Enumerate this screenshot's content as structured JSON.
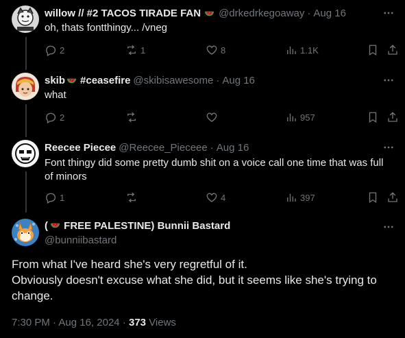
{
  "tweets": [
    {
      "name": "willow // #2 TACOS TIRADE FAN",
      "handle": "@drkedrkegoaway",
      "date": "Aug 16",
      "text": "oh, thats fontthingy... /vneg",
      "replies": "2",
      "reposts": "1",
      "likes": "8",
      "views": "1.1K"
    },
    {
      "name": "skib",
      "name_suffix": "#ceasefire",
      "handle": "@skibisawesome",
      "date": "Aug 16",
      "text": "what",
      "replies": "2",
      "reposts": "",
      "likes": "",
      "views": "957"
    },
    {
      "name": "Reecee Piecee",
      "handle": "@Reecee_Pieceee",
      "date": "Aug 16",
      "text": "Font thingy did some pretty dumb shit on a voice call one time that was full of minors",
      "replies": "1",
      "reposts": "",
      "likes": "4",
      "views": "397"
    }
  ],
  "main": {
    "name_prefix": "(",
    "name_rest": " FREE PALESTINE) Bunnii Bastard",
    "handle": "@bunniibastard",
    "line1": "From what I've heard she's very regretful of it.",
    "line2": "Obviously doesn't excuse what she did, but it seems like she's trying to change.",
    "time": "7:30 PM",
    "date": "Aug 16, 2024",
    "views_count": "373",
    "views_label": "Views"
  },
  "ui": {
    "sep": "·"
  },
  "icons": [
    "watermelon-icon",
    "more-icon",
    "reply-icon",
    "repost-icon",
    "like-icon",
    "views-icon",
    "bookmark-icon",
    "share-icon"
  ],
  "colors": {
    "background": "#000000",
    "text": "#e7e9ea",
    "muted": "#71767b",
    "thread_line": "#333639"
  }
}
